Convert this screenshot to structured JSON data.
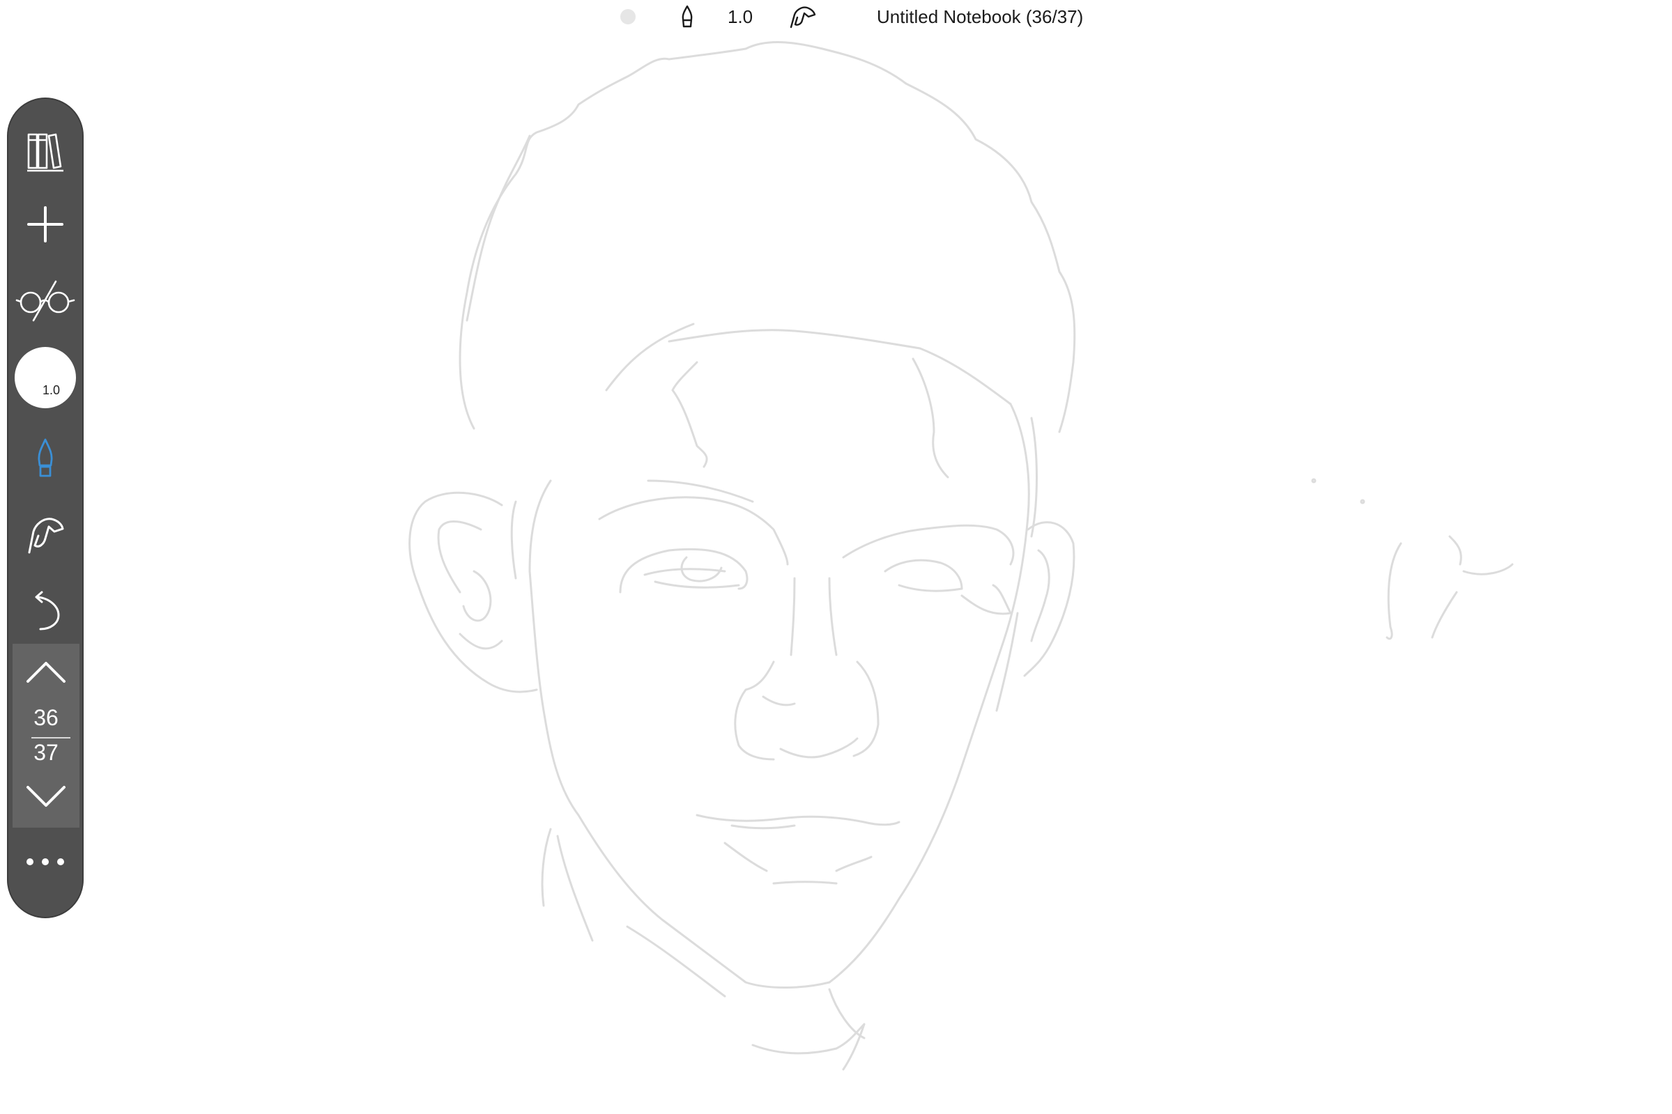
{
  "topbar": {
    "color_icon": "color-dot-icon",
    "pen_icon": "pen-nib-icon",
    "brush_size": "1.0",
    "finger_icon": "finger-draw-icon",
    "title": "Untitled Notebook (36/37)"
  },
  "toolbar": {
    "library_icon": "library-books-icon",
    "add_icon": "plus-icon",
    "glasses_icon": "glasses-icon",
    "brush_size": "1.0",
    "pen_icon": "pen-nib-icon",
    "finger_icon": "finger-draw-icon",
    "undo_icon": "undo-icon",
    "more_icon": "more-dots-icon",
    "pager": {
      "up_icon": "chevron-up-icon",
      "current_page": "36",
      "total_pages": "37",
      "down_icon": "chevron-down-icon"
    }
  },
  "colors": {
    "toolbar_bg": "#505050",
    "pager_bg": "#646464",
    "active_tool": "#3a8fd6",
    "sketch_stroke": "#d9d9d9"
  }
}
